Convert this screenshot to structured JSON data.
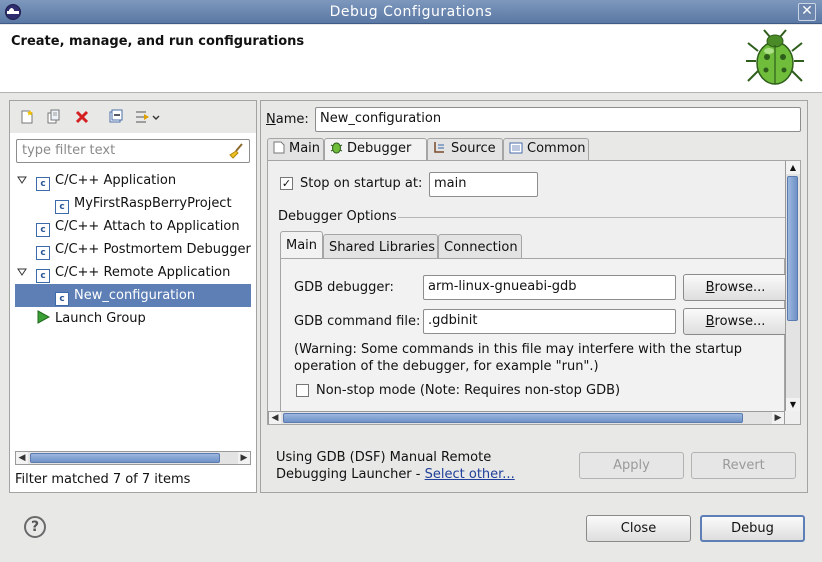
{
  "window": {
    "title": "Debug Configurations"
  },
  "header": {
    "title": "Create, manage, and run configurations",
    "icon": "bug-icon"
  },
  "left": {
    "toolbar": [
      "new-config-icon",
      "duplicate-icon",
      "delete-icon",
      "collapse-all-icon",
      "filter-menu-icon"
    ],
    "filter_placeholder": "type filter text",
    "tree": [
      {
        "label": "C/C++ Application",
        "expanded": true
      },
      {
        "label": "MyFirstRaspBerryProject"
      },
      {
        "label": "C/C++ Attach to Application"
      },
      {
        "label": "C/C++ Postmortem Debugger"
      },
      {
        "label": "C/C++ Remote Application",
        "expanded": true
      },
      {
        "label": "New_configuration",
        "selected": true
      },
      {
        "label": "Launch Group"
      }
    ],
    "status": "Filter matched 7 of 7 items"
  },
  "right": {
    "name_label": "Name:",
    "name_value": "New_configuration",
    "tabs": [
      "Main",
      "Debugger",
      "Source",
      "Common"
    ],
    "active_tab": "Debugger",
    "stop_on_startup_label": "Stop on startup at:",
    "stop_on_startup_checked": true,
    "stop_on_startup_value": "main",
    "debugger_options_label": "Debugger Options",
    "subtabs": [
      "Main",
      "Shared Libraries",
      "Connection"
    ],
    "gdb_debugger_label": "GDB debugger:",
    "gdb_debugger_value": "arm-linux-gnueabi-gdb",
    "gdb_command_file_label": "GDB command file:",
    "gdb_command_file_value": ".gdbinit",
    "browse_label": "Browse...",
    "warning_line1": "(Warning: Some commands in this file may interfere with the startup",
    "warning_line2": "operation of the debugger, for example \"run\".)",
    "nonstop_label": "Non-stop mode (Note: Requires non-stop GDB)",
    "nonstop_checked": false,
    "launcher_line1": "Using GDB (DSF) Manual Remote",
    "launcher_line2": "Debugging Launcher - ",
    "select_other": "Select other...",
    "apply": "Apply",
    "revert": "Revert"
  },
  "footer": {
    "close": "Close",
    "debug": "Debug"
  }
}
